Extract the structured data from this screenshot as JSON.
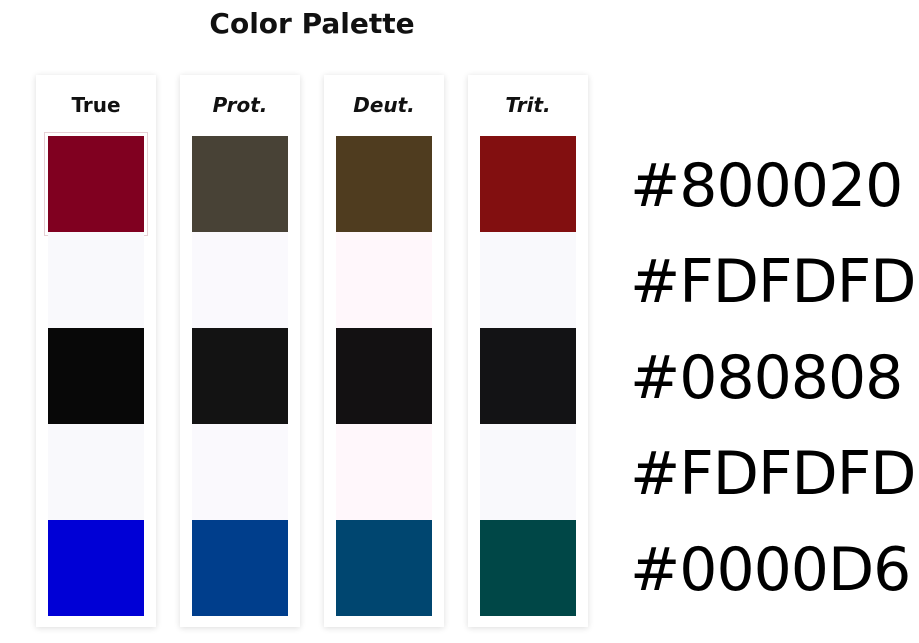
{
  "title": "Color Palette",
  "columns": [
    {
      "label": "True",
      "swatches": [
        "#800020",
        "#F9F9FC",
        "#080808",
        "#F9F9FC",
        "#0000D6"
      ]
    },
    {
      "label": "Prot.",
      "swatches": [
        "#484236",
        "#FAF9FD",
        "#131313",
        "#FAF9FD",
        "#003E8C"
      ]
    },
    {
      "label": "Deut.",
      "swatches": [
        "#4F3C1F",
        "#FFF7FB",
        "#131112",
        "#FFF7FB",
        "#004670"
      ]
    },
    {
      "label": "Trit.",
      "swatches": [
        "#820F10",
        "#F9F9FC",
        "#131315",
        "#F9F9FC",
        "#004747"
      ]
    }
  ],
  "hex_codes": [
    "#800020",
    "#FDFDFD",
    "#080808",
    "#FDFDFD",
    "#0000D6"
  ]
}
